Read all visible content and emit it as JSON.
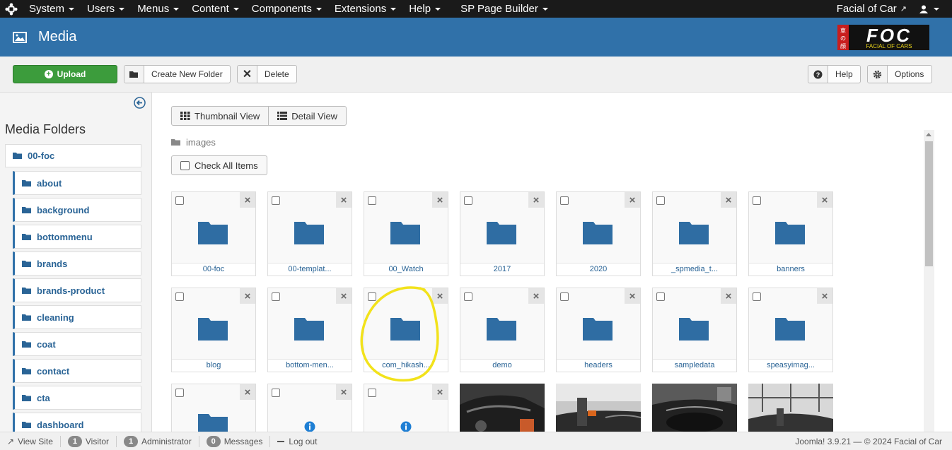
{
  "navbar": {
    "items": [
      {
        "label": "System"
      },
      {
        "label": "Users"
      },
      {
        "label": "Menus"
      },
      {
        "label": "Content"
      },
      {
        "label": "Components"
      },
      {
        "label": "Extensions"
      },
      {
        "label": "Help"
      },
      {
        "label": "SP Page Builder"
      }
    ],
    "site_name": "Facial of Car"
  },
  "header": {
    "title": "Media",
    "logo_text": "FOC",
    "logo_tagline": "FACIAL OF CARS",
    "logo_cjk": "車の顔"
  },
  "toolbar": {
    "upload_label": "Upload",
    "create_folder_label": "Create New Folder",
    "delete_label": "Delete",
    "help_label": "Help",
    "options_label": "Options"
  },
  "sidebar": {
    "title": "Media Folders",
    "root": "00-foc",
    "items": [
      {
        "label": "about"
      },
      {
        "label": "background"
      },
      {
        "label": "bottommenu"
      },
      {
        "label": "brands"
      },
      {
        "label": "brands-product"
      },
      {
        "label": "cleaning"
      },
      {
        "label": "coat"
      },
      {
        "label": "contact"
      },
      {
        "label": "cta"
      },
      {
        "label": "dashboard"
      }
    ]
  },
  "main": {
    "thumbnail_view_label": "Thumbnail View",
    "detail_view_label": "Detail View",
    "path": "images",
    "check_all_label": "Check All Items",
    "folders_row1": [
      "00-foc",
      "00-templat...",
      "00_Watch",
      "2017",
      "2020",
      "_spmedia_t...",
      "banners"
    ],
    "folders_row2": [
      "blog",
      "bottom-men...",
      "com_hikash...",
      "demo",
      "headers",
      "sampledata",
      "speasyimag..."
    ]
  },
  "statusbar": {
    "view_site": "View Site",
    "visitor_count": "1",
    "visitor_label": "Visitor",
    "admin_count": "1",
    "admin_label": "Administrator",
    "messages_count": "0",
    "messages_label": "Messages",
    "logout_label": "Log out",
    "version": "Joomla! 3.9.21",
    "copyright": "© 2024 Facial of Car"
  },
  "colors": {
    "header_bg": "#3071a9",
    "folder": "#2f6da3",
    "upload_green": "#3c9c3c",
    "highlight": "#f2e21b"
  }
}
